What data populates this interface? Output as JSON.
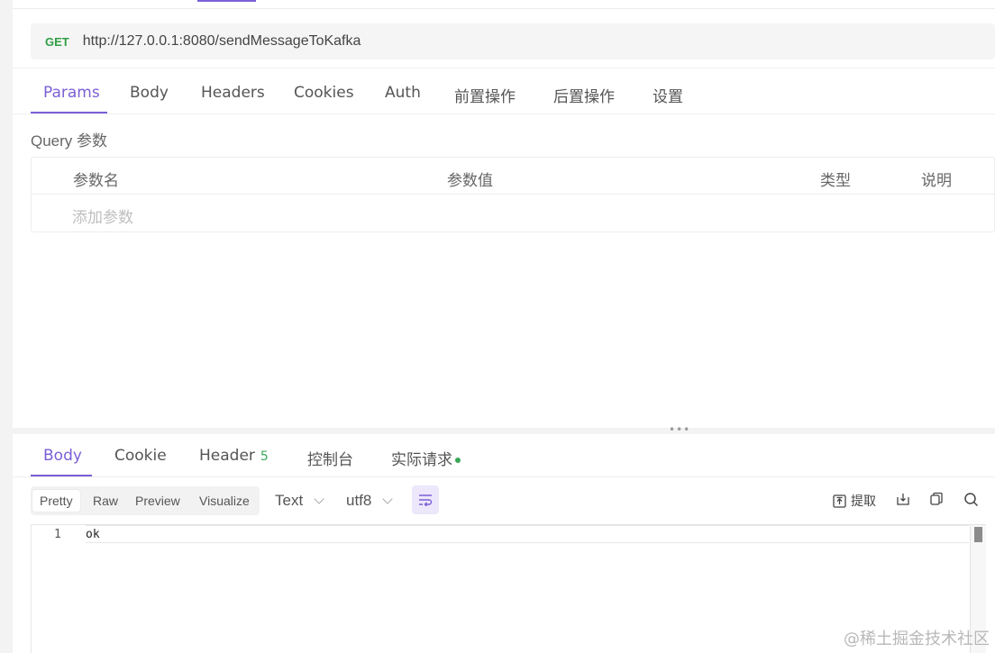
{
  "request": {
    "method": "GET",
    "url": "http://127.0.0.1:8080/sendMessageToKafka",
    "tabs": [
      "Params",
      "Body",
      "Headers",
      "Cookies",
      "Auth",
      "前置操作",
      "后置操作",
      "设置"
    ],
    "active_tab": "Params",
    "query_label": "Query 参数",
    "table_headers": [
      "参数名",
      "参数值",
      "类型",
      "说明"
    ],
    "add_param_placeholder": "添加参数"
  },
  "response": {
    "tabs": [
      {
        "label": "Body"
      },
      {
        "label": "Cookie"
      },
      {
        "label": "Header",
        "count": "5"
      },
      {
        "label": "控制台"
      },
      {
        "label": "实际请求",
        "indicator": "green-dot"
      }
    ],
    "active_tab": "Body",
    "view_modes": [
      "Pretty",
      "Raw",
      "Preview",
      "Visualize"
    ],
    "active_view": "Pretty",
    "format": "Text",
    "encoding": "utf8",
    "tools": {
      "extract_label": "提取"
    },
    "lines": [
      {
        "number": "1",
        "text": "ok"
      }
    ]
  },
  "colors": {
    "accent": "#7b5fd6",
    "method_get": "#2f9e44",
    "status_green": "#3aa757"
  },
  "watermark": "@稀土掘金技术社区"
}
